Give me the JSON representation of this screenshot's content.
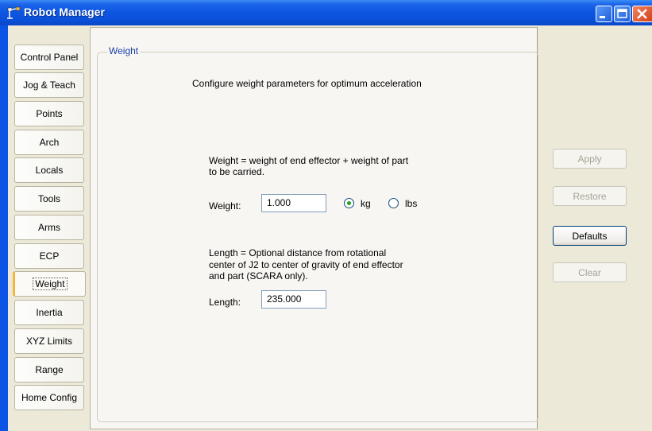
{
  "window": {
    "title": "Robot Manager"
  },
  "tabs": [
    {
      "label": "Control Panel"
    },
    {
      "label": "Jog & Teach"
    },
    {
      "label": "Points"
    },
    {
      "label": "Arch"
    },
    {
      "label": "Locals"
    },
    {
      "label": "Tools"
    },
    {
      "label": "Arms"
    },
    {
      "label": "ECP"
    },
    {
      "label": "Weight",
      "active": true
    },
    {
      "label": "Inertia"
    },
    {
      "label": "XYZ Limits"
    },
    {
      "label": "Range"
    },
    {
      "label": "Home Config"
    }
  ],
  "weight_panel": {
    "group_title": "Weight",
    "description": "Configure weight parameters for optimum acceleration",
    "weight_help_line1": "Weight = weight of end effector + weight of part",
    "weight_help_line2": "to be carried.",
    "weight_label": "Weight:",
    "weight_value": "1.000",
    "unit_kg_label": "kg",
    "unit_lbs_label": "lbs",
    "selected_unit": "kg",
    "length_help_line1": "Length = Optional distance from rotational",
    "length_help_line2": "center of J2 to center of gravity of end effector",
    "length_help_line3": "and part (SCARA only).",
    "length_label": "Length:",
    "length_value": "235.000"
  },
  "buttons": {
    "apply": {
      "label": "Apply",
      "enabled": false
    },
    "restore": {
      "label": "Restore",
      "enabled": false
    },
    "defaults": {
      "label": "Defaults",
      "enabled": true
    },
    "clear": {
      "label": "Clear",
      "enabled": false
    }
  },
  "colors": {
    "titlebar_blue": "#0b54e6",
    "active_tab_accent": "#f6b53a",
    "group_title": "#1a3fa8",
    "radio_dot": "#21a121"
  }
}
